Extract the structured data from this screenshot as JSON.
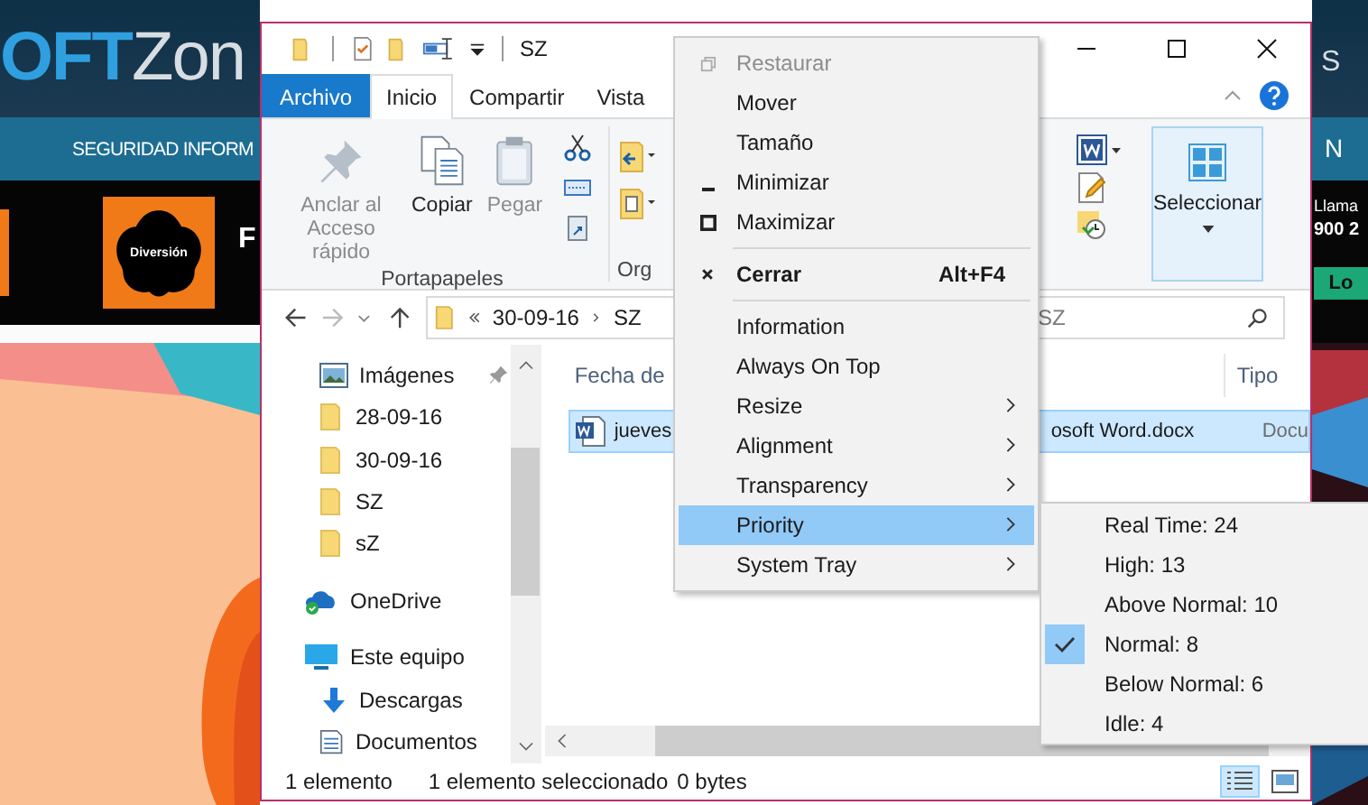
{
  "website": {
    "logo": "**OFT**Zon",
    "header_right": "S",
    "nav_left": "SEGURIDAD INFORM",
    "nav_right": "N",
    "tile_label": "Diversión",
    "heading_fragment": "F",
    "ad_line_1": "Llama",
    "ad_line_2": "900 2",
    "ad_button": "Lo"
  },
  "explorer": {
    "title": "SZ",
    "tabs": [
      {
        "label": "Archivo",
        "kind": "file",
        "selected": false
      },
      {
        "label": "Inicio",
        "kind": "tab",
        "selected": true
      },
      {
        "label": "Compartir",
        "kind": "tab",
        "selected": false
      },
      {
        "label": "Vista",
        "kind": "tab",
        "selected": false
      }
    ],
    "ribbon": {
      "clipboard": {
        "label": "Portapapeles",
        "buttons": [
          {
            "label": "Anclar al Acceso rápido",
            "kind": "pin",
            "disabled": true
          },
          {
            "label": "Copiar",
            "kind": "copy",
            "disabled": false
          },
          {
            "label": "Pegar",
            "kind": "paste",
            "disabled": true
          }
        ]
      },
      "organize_label": "Org",
      "select_button": "Seleccionar"
    },
    "address": {
      "path": [
        "30-09-16",
        "SZ"
      ]
    },
    "search": {
      "placeholder": "SZ"
    },
    "nav_pane": {
      "quick_access": [
        {
          "label": "Imágenes",
          "kind": "pictures",
          "pinned": true
        },
        {
          "label": "28-09-16",
          "kind": "folder",
          "pinned": false
        },
        {
          "label": "30-09-16",
          "kind": "folder",
          "pinned": false
        },
        {
          "label": "SZ",
          "kind": "folder",
          "pinned": false
        },
        {
          "label": "sZ",
          "kind": "folder",
          "pinned": false
        }
      ],
      "locations": [
        {
          "label": "OneDrive",
          "kind": "onedrive"
        },
        {
          "label": "Este equipo",
          "kind": "pc",
          "children": [
            {
              "label": "Descargas",
              "kind": "downloads"
            },
            {
              "label": "Documentos",
              "kind": "documents"
            }
          ]
        }
      ]
    },
    "columns": [
      "Fecha de",
      "Tipo"
    ],
    "rows": [
      {
        "cells": [
          "jueves",
          "osoft Word.docx",
          "Docu"
        ],
        "selected": true
      }
    ],
    "status_bar": [
      "1 elemento",
      "1 elemento seleccionado",
      "0 bytes"
    ],
    "view_buttons": [
      {
        "kind": "details",
        "selected": true
      },
      {
        "kind": "large_icons",
        "selected": false
      }
    ]
  },
  "context_menu": {
    "items": [
      {
        "kind": "restore",
        "label": "Restaurar",
        "disabled": true,
        "default": false,
        "submenu": false,
        "selected": false
      },
      {
        "kind": "item",
        "label": "Mover",
        "disabled": false,
        "default": false,
        "submenu": false,
        "selected": false
      },
      {
        "kind": "item",
        "label": "Tamaño",
        "disabled": false,
        "default": false,
        "submenu": false,
        "selected": false
      },
      {
        "kind": "minimize",
        "label": "Minimizar",
        "disabled": false,
        "default": false,
        "submenu": false,
        "selected": false
      },
      {
        "kind": "maximize",
        "label": "Maximizar",
        "disabled": false,
        "default": false,
        "submenu": false,
        "selected": false
      },
      {
        "kind": "separator"
      },
      {
        "kind": "close",
        "label": "Cerrar",
        "shortcut": "Alt+F4",
        "disabled": false,
        "default": true,
        "submenu": false,
        "selected": false
      },
      {
        "kind": "separator"
      },
      {
        "kind": "item",
        "label": "Information",
        "disabled": false,
        "default": false,
        "submenu": false,
        "selected": false
      },
      {
        "kind": "item",
        "label": "Always On Top",
        "disabled": false,
        "default": false,
        "submenu": false,
        "selected": false
      },
      {
        "kind": "item",
        "label": "Resize",
        "disabled": false,
        "default": false,
        "submenu": true,
        "selected": false
      },
      {
        "kind": "item",
        "label": "Alignment",
        "disabled": false,
        "default": false,
        "submenu": true,
        "selected": false
      },
      {
        "kind": "item",
        "label": "Transparency",
        "disabled": false,
        "default": false,
        "submenu": true,
        "selected": false
      },
      {
        "kind": "item",
        "label": "Priority",
        "disabled": false,
        "default": false,
        "submenu": true,
        "selected": true
      },
      {
        "kind": "item",
        "label": "System Tray",
        "disabled": false,
        "default": false,
        "submenu": true,
        "selected": false
      }
    ]
  },
  "priority_menu": {
    "items": [
      {
        "label": "Real Time: 24",
        "checked": false
      },
      {
        "label": "High: 13",
        "checked": false
      },
      {
        "label": "Above Normal: 10",
        "checked": false
      },
      {
        "label": "Normal: 8",
        "checked": true
      },
      {
        "label": "Below Normal: 6",
        "checked": false
      },
      {
        "label": "Idle: 4",
        "checked": false
      }
    ]
  }
}
